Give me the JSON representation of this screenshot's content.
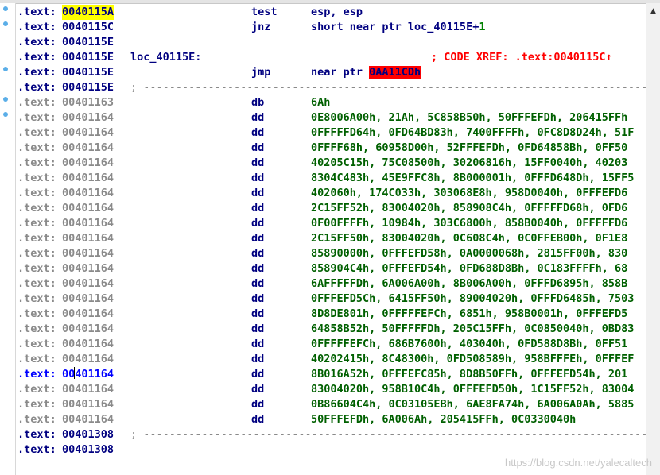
{
  "colors": {
    "segment_navy": "#000080",
    "address_gray": "#8a8a8a",
    "operand_green": "#006000",
    "highlight_yellow": "#ffff00",
    "xref_red": "#ff0000",
    "breakpoint_dot": "#5aaee8"
  },
  "gutter": {
    "marker_rows": [
      0,
      1,
      4,
      6,
      7
    ]
  },
  "rows": [
    {
      "seg": ".text:",
      "addr": "0040115A",
      "style": "hl",
      "mnem": "test",
      "ops": "esp, esp"
    },
    {
      "seg": ".text:",
      "addr": "0040115C",
      "style": "normal",
      "mnem": "jnz",
      "ops": "short near ptr loc_40115E+",
      "ops_num": "1"
    },
    {
      "seg": ".text:",
      "addr": "0040115E",
      "style": "normal"
    },
    {
      "seg": ".text:",
      "addr": "0040115E",
      "style": "normal",
      "label": "loc_40115E:",
      "comment": "; CODE XREF: .text:0040115C",
      "comment_arrow": "↑"
    },
    {
      "seg": ".text:",
      "addr": "0040115E",
      "style": "normal",
      "mnem": "jmp",
      "ops": "near ptr ",
      "ops_ref": "0AA11CDh"
    },
    {
      "seg": ".text:",
      "addr": "0040115E",
      "style": "normal",
      "separator": "; ------------------------------------------------------------------------------------------------"
    },
    {
      "seg": ".text:",
      "addr": "00401163",
      "style": "gray",
      "mnem": "db",
      "ops": "6Ah"
    },
    {
      "seg": ".text:",
      "addr": "00401164",
      "style": "gray",
      "mnem": "dd",
      "ops": "0E8006A00h, 21Ah, 5C858B50h, 50FFFEFDh, 206415FFh"
    },
    {
      "seg": ".text:",
      "addr": "00401164",
      "style": "gray",
      "mnem": "dd",
      "ops": "0FFFFFD64h, 0FD64BD83h, 7400FFFFh, 0FC8D8D24h, 51F"
    },
    {
      "seg": ".text:",
      "addr": "00401164",
      "style": "gray",
      "mnem": "dd",
      "ops": "0FFFF68h, 60958D00h, 52FFFEFDh, 0FD64858Bh, 0FF50"
    },
    {
      "seg": ".text:",
      "addr": "00401164",
      "style": "gray",
      "mnem": "dd",
      "ops": "40205C15h, 75C08500h, 30206816h, 15FF0040h, 40203"
    },
    {
      "seg": ".text:",
      "addr": "00401164",
      "style": "gray",
      "mnem": "dd",
      "ops": "8304C483h, 45E9FFC8h, 8B000001h, 0FFFD648Dh, 15FF5"
    },
    {
      "seg": ".text:",
      "addr": "00401164",
      "style": "gray",
      "mnem": "dd",
      "ops": "402060h, 174C033h, 303068E8h, 958D0040h, 0FFFEFD6"
    },
    {
      "seg": ".text:",
      "addr": "00401164",
      "style": "gray",
      "mnem": "dd",
      "ops": "2C15FF52h, 83004020h, 858908C4h, 0FFFFFD68h, 0FD6"
    },
    {
      "seg": ".text:",
      "addr": "00401164",
      "style": "gray",
      "mnem": "dd",
      "ops": "0F00FFFFh, 10984h, 303C6800h, 858B0040h, 0FFFFFD6"
    },
    {
      "seg": ".text:",
      "addr": "00401164",
      "style": "gray",
      "mnem": "dd",
      "ops": "2C15FF50h, 83004020h, 0C608C4h, 0C0FFEB00h, 0F1E8"
    },
    {
      "seg": ".text:",
      "addr": "00401164",
      "style": "gray",
      "mnem": "dd",
      "ops": "85890000h, 0FFFEFD58h, 0A0000068h, 2815FF00h, 830"
    },
    {
      "seg": ".text:",
      "addr": "00401164",
      "style": "gray",
      "mnem": "dd",
      "ops": "858904C4h, 0FFFEFD54h, 0FD688D8Bh, 0C183FFFFh, 68"
    },
    {
      "seg": ".text:",
      "addr": "00401164",
      "style": "gray",
      "mnem": "dd",
      "ops": "6AFFFFFDh, 6A006A00h, 8B006A00h, 0FFFD6895h, 858B"
    },
    {
      "seg": ".text:",
      "addr": "00401164",
      "style": "gray",
      "mnem": "dd",
      "ops": "0FFFEFD5Ch, 6415FF50h, 89004020h, 0FFFD6485h, 7503"
    },
    {
      "seg": ".text:",
      "addr": "00401164",
      "style": "gray",
      "mnem": "dd",
      "ops": "8D8DE801h, 0FFFFFEFCh, 6851h, 958B0001h, 0FFFEFD5"
    },
    {
      "seg": ".text:",
      "addr": "00401164",
      "style": "gray",
      "mnem": "dd",
      "ops": "64858B52h, 50FFFFFDh, 205C15FFh, 0C0850040h, 0BD83"
    },
    {
      "seg": ".text:",
      "addr": "00401164",
      "style": "gray",
      "mnem": "dd",
      "ops": "0FFFFFEFCh, 686B7600h, 403040h, 0FD588D8Bh, 0FF51"
    },
    {
      "seg": ".text:",
      "addr": "00401164",
      "style": "gray",
      "mnem": "dd",
      "ops": "40202415h, 8C48300h, 0FD508589h, 958BFFFEh, 0FFFEF"
    },
    {
      "seg": ".text:",
      "addr": "00401164",
      "style": "cur",
      "mnem": "dd",
      "ops": "8B016A52h, 0FFFEFC85h, 8D8B50FFh, 0FFFEFD54h, 201"
    },
    {
      "seg": ".text:",
      "addr": "00401164",
      "style": "gray",
      "mnem": "dd",
      "ops": "83004020h, 958B10C4h, 0FFFEFD50h, 1C15FF52h, 83004"
    },
    {
      "seg": ".text:",
      "addr": "00401164",
      "style": "gray",
      "mnem": "dd",
      "ops": "0B86604C4h, 0C03105EBh, 6AE8FA74h, 6A006A0Ah, 5885"
    },
    {
      "seg": ".text:",
      "addr": "00401164",
      "style": "gray",
      "mnem": "dd",
      "ops": "50FFFEFDh, 6A006Ah, 205415FFh, 0C0330040h"
    },
    {
      "seg": ".text:",
      "addr": "00401308",
      "style": "normal",
      "separator": "; ------------------------------------------------------------------------------------------------"
    },
    {
      "seg": ".text:",
      "addr": "00401308",
      "style": "normal"
    }
  ],
  "watermark": "https://blog.csdn.net/yalecaltech"
}
